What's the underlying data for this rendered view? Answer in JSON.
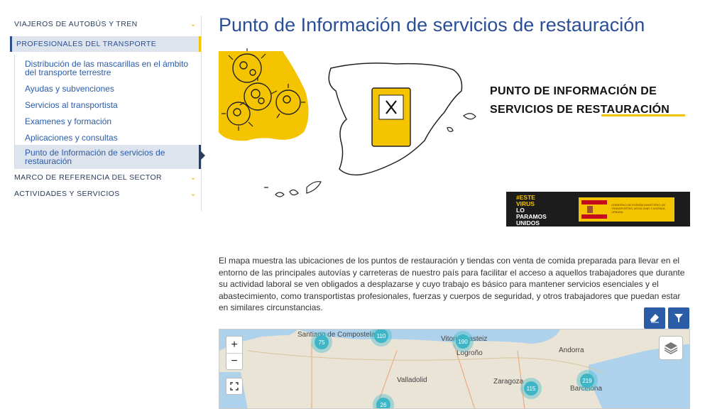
{
  "sidebar": {
    "sections": [
      {
        "label": "VIAJEROS DE AUTOBÚS Y TREN"
      },
      {
        "label": "PROFESIONALES DEL TRANSPORTE"
      },
      {
        "label": "MARCO DE REFERENCIA DEL SECTOR"
      },
      {
        "label": "ACTIVIDADES Y SERVICIOS"
      }
    ],
    "sub_items": [
      {
        "label": "Distribución de las mascarillas en el ámbito del transporte terrestre"
      },
      {
        "label": "Ayudas y subvenciones"
      },
      {
        "label": "Servicios al transportista"
      },
      {
        "label": "Examenes y formación"
      },
      {
        "label": "Aplicaciones y consultas"
      },
      {
        "label": "Punto de Información de servicios de restauración"
      }
    ]
  },
  "page": {
    "title": "Punto de Información de servicios de restauración",
    "poster_line1": "PUNTO DE INFORMACIÓN DE",
    "poster_line2": "SERVICIOS DE RESTAURACIÓN",
    "badge": {
      "line1": "#ESTE",
      "line2": "VIRUS",
      "line3": "LO",
      "line4": "PARAMOS",
      "line5": "UNIDOS",
      "gov_left": "GOBIERNO DE ESPAÑA",
      "gov_right": "MINISTERIO DE TRANSPORTES, MOVILIDAD Y AGENDA URBANA"
    },
    "description": "El mapa muestra las ubicaciones de los puntos de restauración y tiendas con venta de comida preparada para llevar en el entorno de las principales autovías y carreteras de nuestro país para facilitar el acceso a aquellos trabajadores que durante su actividad laboral se ven obligados a desplazarse y cuyo trabajo es básico para mantener servicios esenciales y el abastecimiento, como transportistas profesionales, fuerzas y cuerpos de seguridad, y otros trabajadores que puedan estar en similares circunstancias."
  },
  "map": {
    "zoom_in": "+",
    "zoom_out": "−",
    "clusters": [
      "75",
      "110",
      "190",
      "115",
      "219",
      "26"
    ],
    "cities": [
      "Santiago de Compostela",
      "Vitoria-Gasteiz",
      "Logroño",
      "Andorra",
      "Valladolid",
      "Zaragoza",
      "Barcelona"
    ]
  },
  "colors": {
    "primary": "#2a4f95",
    "accent": "#f5c400",
    "cluster": "#3fb6c8"
  },
  "icons": [
    "chevron-down-icon",
    "eraser-icon",
    "filter-icon",
    "fullscreen-icon",
    "layers-icon",
    "restaurant-icon",
    "virus-icon"
  ]
}
